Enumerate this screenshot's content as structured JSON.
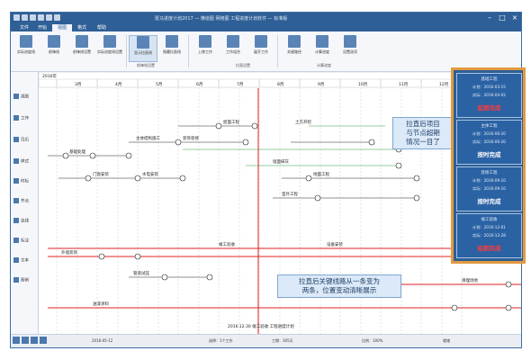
{
  "window": {
    "title": "斑马进度计划2017 — 横道图 网络图 工程进度计划软件 — 标准版",
    "controls": [
      "–",
      "□",
      "×"
    ]
  },
  "menubar": {
    "items": [
      "文件",
      "开始",
      "视图",
      "格式",
      "帮助"
    ],
    "active_index": 2
  },
  "ribbon": {
    "buttons": [
      "实际进度线",
      "前锋线",
      "前锋线设置",
      "实际进度线设置",
      "显示拉直线",
      "隐藏拉直线",
      "上移工作",
      "工作组合",
      "展开工作",
      "关键路径",
      "计算进度",
      "设置选项"
    ],
    "groups": [
      "前锋线设置",
      "拉直设置",
      "计算进度"
    ]
  },
  "sidebar": {
    "items": [
      "视图",
      "工作",
      "日历",
      "样式",
      "时标",
      "节点",
      "连线",
      "标注",
      "文本",
      "图例"
    ]
  },
  "ruler": {
    "months": [
      "2016年",
      "3月",
      "4月",
      "5月",
      "6月",
      "7月",
      "8月",
      "9月",
      "10月",
      "11月",
      "12月"
    ]
  },
  "network": {
    "labels": [
      "基础处理",
      "主体结构施工",
      "装饰装修",
      "屋面工程",
      "门窗安装",
      "水电安装",
      "墙面抹灰",
      "地面工程",
      "室外工程",
      "竣工验收",
      "设备安装",
      "外墙装饰",
      "管道试压",
      "油漆涂料",
      "清理场地",
      "土方开挖"
    ],
    "bottom_label": "2016.12.30 竣工验收  工程进度计划"
  },
  "annotations": {
    "top": "拉直后项目\n与节点超期\n情况一目了",
    "bottom": "拉直后关键线路从一条变为\n两条，位置变动清晰展示"
  },
  "status_panel": [
    {
      "name": "基础工程",
      "plan": "计划：2016-03-15",
      "actual": "实际：2016-04-02",
      "status": "延期完成",
      "kind": "late"
    },
    {
      "name": "主体工程",
      "plan": "计划：2016-06-20",
      "actual": "实际：2016-06-20",
      "status": "按时完成",
      "kind": "ok"
    },
    {
      "name": "装修工程",
      "plan": "计划：2016-09-10",
      "actual": "实际：2016-09-10",
      "status": "按时完成",
      "kind": "ok"
    },
    {
      "name": "竣工验收",
      "plan": "计划：2016-12-01",
      "actual": "实际：2016-12-28",
      "status": "延期完成",
      "kind": "late"
    }
  ],
  "statusbar": {
    "left": "2016-05-12",
    "mid1": "选择：1个工作",
    "mid2": "工期：305天",
    "right1": "比例：100%",
    "right2": "就绪"
  },
  "colors": {
    "critical": "#e02020",
    "normal": "#222222",
    "panel_border": "#e39a3f"
  }
}
